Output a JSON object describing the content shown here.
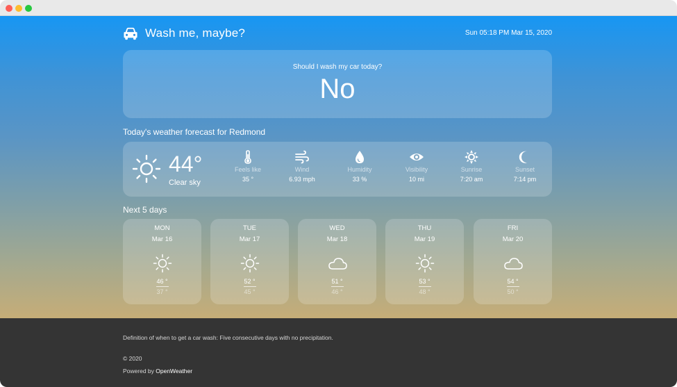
{
  "app": {
    "title": "Wash me, maybe?",
    "datetime": "Sun 05:18 PM Mar 15, 2020"
  },
  "answer": {
    "question": "Should I wash my car today?",
    "value": "No"
  },
  "today": {
    "heading": "Today's weather forecast for Redmond",
    "temperature": "44°",
    "condition": "Clear sky",
    "icon": "sun-icon",
    "stats": [
      {
        "icon": "thermometer-icon",
        "label": "Feels like",
        "value": "35 °"
      },
      {
        "icon": "wind-icon",
        "label": "Wind",
        "value": "6.93 mph"
      },
      {
        "icon": "droplet-icon",
        "label": "Humidity",
        "value": "33 %"
      },
      {
        "icon": "eye-icon",
        "label": "Visibility",
        "value": "10 mi"
      },
      {
        "icon": "sunrise-icon",
        "label": "Sunrise",
        "value": "7:20 am"
      },
      {
        "icon": "moon-icon",
        "label": "Sunset",
        "value": "7:14 pm"
      }
    ]
  },
  "forecast": {
    "heading": "Next 5 days",
    "days": [
      {
        "day": "MON",
        "date": "Mar 16",
        "icon": "sun-icon",
        "high": "46 °",
        "low": "37 °"
      },
      {
        "day": "TUE",
        "date": "Mar 17",
        "icon": "sun-icon",
        "high": "52 °",
        "low": "45 °"
      },
      {
        "day": "WED",
        "date": "Mar 18",
        "icon": "cloud-icon",
        "high": "51 °",
        "low": "46 °"
      },
      {
        "day": "THU",
        "date": "Mar 19",
        "icon": "sun-icon",
        "high": "53 °",
        "low": "48 °"
      },
      {
        "day": "FRI",
        "date": "Mar 20",
        "icon": "cloud-icon",
        "high": "54 °",
        "low": "50 °"
      }
    ]
  },
  "footer": {
    "definition": "Definition of when to get a car wash: Five consecutive days with no precipitation.",
    "copyright": "© 2020",
    "powered_prefix": "Powered by",
    "powered_link": "OpenWeather"
  },
  "colors": {
    "gradient_top": "#1796f3",
    "gradient_bottom": "#c6ad77",
    "footer_bg": "#343434",
    "window_close": "#fe5f57",
    "window_minimize": "#febc2e",
    "window_zoom": "#28c840"
  }
}
